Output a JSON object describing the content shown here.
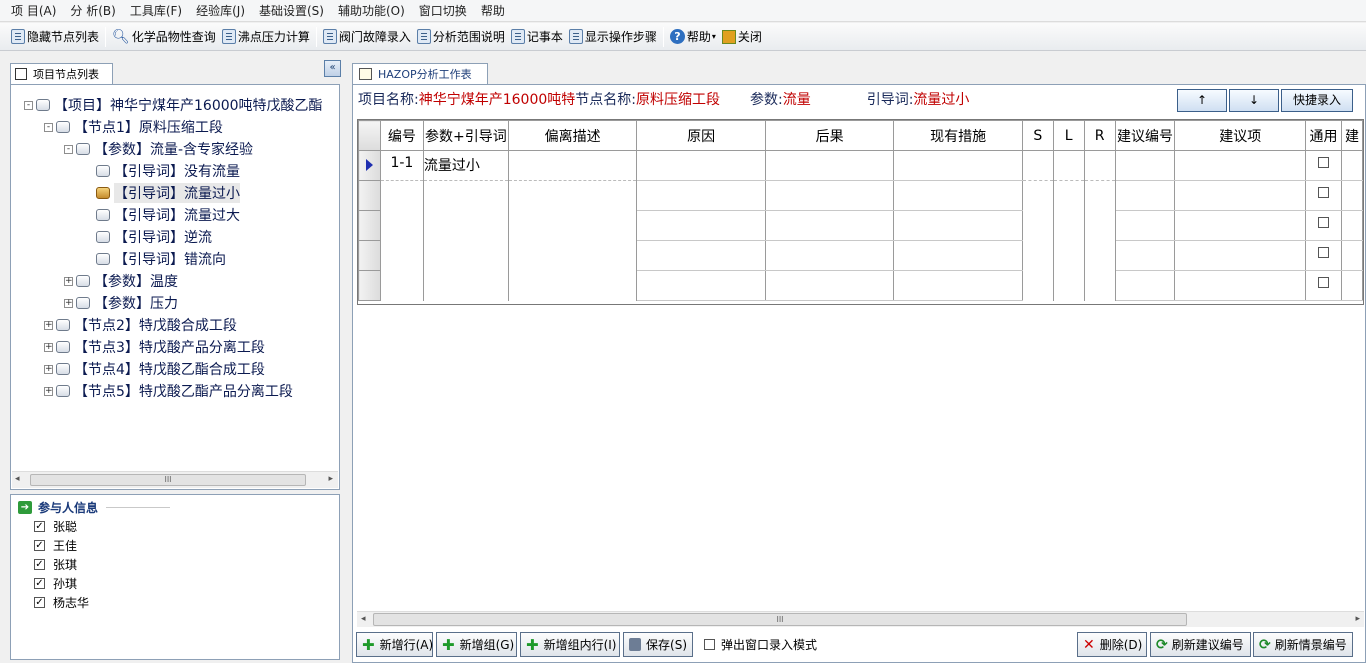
{
  "menu": [
    "项 目(A)",
    "分 析(B)",
    "工具库(F)",
    "经验库(J)",
    "基础设置(S)",
    "辅助功能(O)",
    "窗口切换",
    "帮助"
  ],
  "toolbar": {
    "hide_nodes": "隐藏节点列表",
    "chem_query": "化学品物性查询",
    "boiling_calc": "沸点压力计算",
    "valve_fault": "阀门故障录入",
    "analysis_scope": "分析范围说明",
    "notepad": "记事本",
    "show_steps": "显示操作步骤",
    "help": "帮助",
    "close": "关闭"
  },
  "left_panel": {
    "tab": "项目节点列表",
    "collapse_glyph": "«",
    "tree": [
      {
        "exp": "-",
        "label": "【项目】神华宁煤年产16000吨特戊酸乙酯"
      },
      {
        "exp": "-",
        "label": "【节点1】原料压缩工段"
      },
      {
        "exp": "-",
        "label": "【参数】流量-含专家经验"
      },
      {
        "exp": "",
        "label": "【引导词】没有流量"
      },
      {
        "exp": "",
        "label": "【引导词】流量过小",
        "selected": true
      },
      {
        "exp": "",
        "label": "【引导词】流量过大"
      },
      {
        "exp": "",
        "label": "【引导词】逆流"
      },
      {
        "exp": "",
        "label": "【引导词】错流向"
      },
      {
        "exp": "+",
        "label": "【参数】温度"
      },
      {
        "exp": "+",
        "label": "【参数】压力"
      },
      {
        "exp": "+",
        "label": "【节点2】特戊酸合成工段"
      },
      {
        "exp": "+",
        "label": "【节点3】特戊酸产品分离工段"
      },
      {
        "exp": "+",
        "label": "【节点4】特戊酸乙酯合成工段"
      },
      {
        "exp": "+",
        "label": "【节点5】特戊酸乙酯产品分离工段"
      }
    ],
    "participants_title": "参与人信息",
    "participants": [
      "张聪",
      "王佳",
      "张琪",
      "孙琪",
      "杨志华"
    ]
  },
  "right_panel": {
    "tab": "HAZOP分析工作表",
    "project_label": "项目名称:",
    "project_value": "神华宁煤年产16000吨特",
    "node_label": "节点名称:",
    "node_value": "原料压缩工段",
    "param_label": "参数:",
    "param_value": "流量",
    "guide_label": "引导词:",
    "guide_value": "流量过小",
    "up_label": "↑",
    "down_label": "↓",
    "quick_entry": "快捷录入",
    "columns": [
      "编号",
      "参数+引导词",
      "偏离描述",
      "原因",
      "后果",
      "现有措施",
      "S",
      "L",
      "R",
      "建议编号",
      "建议项",
      "通用",
      "建"
    ],
    "rows": [
      {
        "id": "1-1",
        "param": "流量过小"
      }
    ],
    "popup_mode": "弹出窗口录入模式"
  },
  "buttons": {
    "add_row": "新增行(A)",
    "add_group": "新增组(G)",
    "add_inner_row": "新增组内行(I)",
    "save": "保存(S)",
    "delete": "删除(D)",
    "refresh_suggest": "刷新建议编号",
    "refresh_scene": "刷新情景编号"
  }
}
